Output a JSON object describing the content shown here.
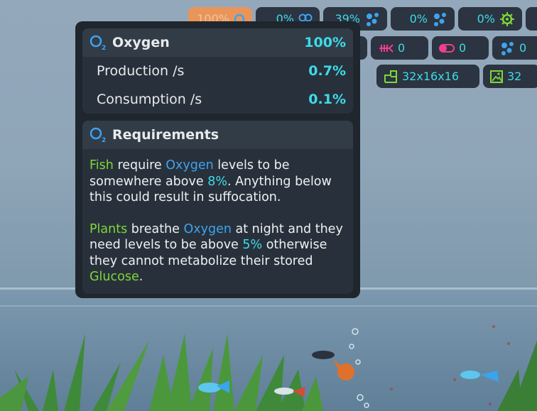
{
  "hud": {
    "top_row": [
      {
        "value": "100%",
        "icon": "oxygen-icon",
        "style": "orange"
      },
      {
        "value": "0%",
        "icon": "co2-icon"
      },
      {
        "value": "39%",
        "icon": "bubbles-icon"
      },
      {
        "value": "0%",
        "icon": "bubbles-icon"
      },
      {
        "value": "0%",
        "icon": "virus-icon"
      }
    ],
    "second_row": [
      {
        "value": "0",
        "icon": "fish-bones-icon"
      },
      {
        "value": "0",
        "icon": "pill-icon"
      },
      {
        "value": "0",
        "icon": "bubbles-icon"
      }
    ],
    "third_row": [
      {
        "value": "32x16x16",
        "icon": "tank-size-icon"
      },
      {
        "value": "32",
        "icon": "image-icon"
      }
    ]
  },
  "tooltip": {
    "oxygen": {
      "title": "Oxygen",
      "value": "100%",
      "production_label": "Production /s",
      "production_value": "0.7%",
      "consumption_label": "Consumption /s",
      "consumption_value": "0.1%"
    },
    "requirements": {
      "title": "Requirements",
      "p1": {
        "subject": "Fish",
        "t1": " require ",
        "gas": "Oxygen",
        "t2": " levels to be somewhere above ",
        "threshold": "8%",
        "t3": ". Anything below this could result in suffocation."
      },
      "p2": {
        "subject": "Plants",
        "t1": " breathe ",
        "gas": "Oxygen",
        "t2": " at night and they need levels to be above ",
        "threshold": "5%",
        "t3": " otherwise they cannot metabolize their stored ",
        "nutrient": "Glucose",
        "t4": "."
      }
    }
  },
  "colors": {
    "accent_cyan": "#3ddbe8",
    "keyword_green": "#7fd63a",
    "keyword_blue": "#3ea3ef",
    "panel_bg": "#1f262e",
    "hud_orange": "#e9955a"
  }
}
